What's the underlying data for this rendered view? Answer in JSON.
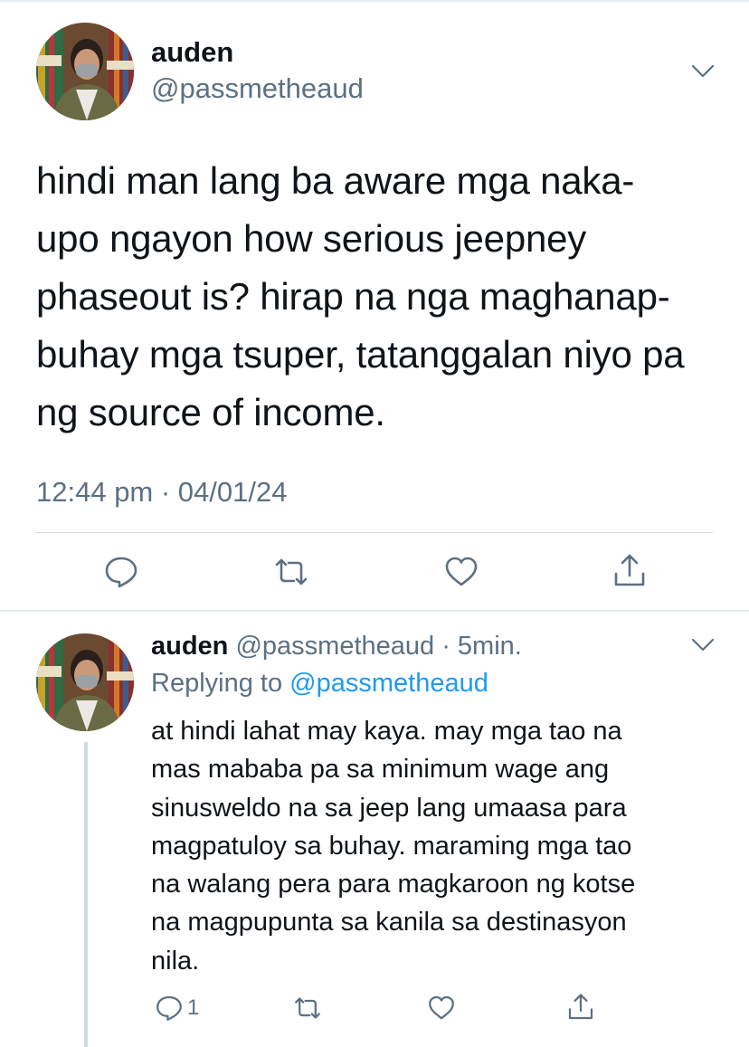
{
  "tweet": {
    "author_name": "auden",
    "author_handle": "@passmetheaud",
    "text_lines": [
      "hindi man lang ba aware mga naka-",
      "upo ngayon how serious jeepney",
      "phaseout is? hirap na nga maghanap-",
      "buhay mga tsuper, tatanggalan niyo pa",
      "ng source of income."
    ],
    "timestamp": "12:44 pm · 04/01/24",
    "actions": {
      "reply_icon": "speech-bubble-icon",
      "retweet_icon": "retweet-arrows-icon",
      "like_icon": "heart-icon",
      "share_icon": "share-upload-icon"
    }
  },
  "reply": {
    "author_name": "auden",
    "author_handle": "@passmetheaud",
    "time_ago": "· 5min.",
    "replying_prefix": "Replying to",
    "replying_handle": "@passmetheaud",
    "text_lines": [
      "at hindi lahat may kaya. may mga tao na",
      "mas mababa pa sa minimum wage ang",
      "sinusweldo na sa jeep lang umaasa para",
      "magpatuloy sa buhay. maraming mga tao",
      "na walang pera para magkaroon ng kotse",
      "na magpupunta sa kanila sa destinasyon",
      "nila."
    ],
    "reply_count": "1"
  },
  "colors": {
    "text_primary": "#0f1419",
    "text_secondary": "#5b7083",
    "link": "#1d9bf0",
    "divider": "#cfd9de"
  }
}
